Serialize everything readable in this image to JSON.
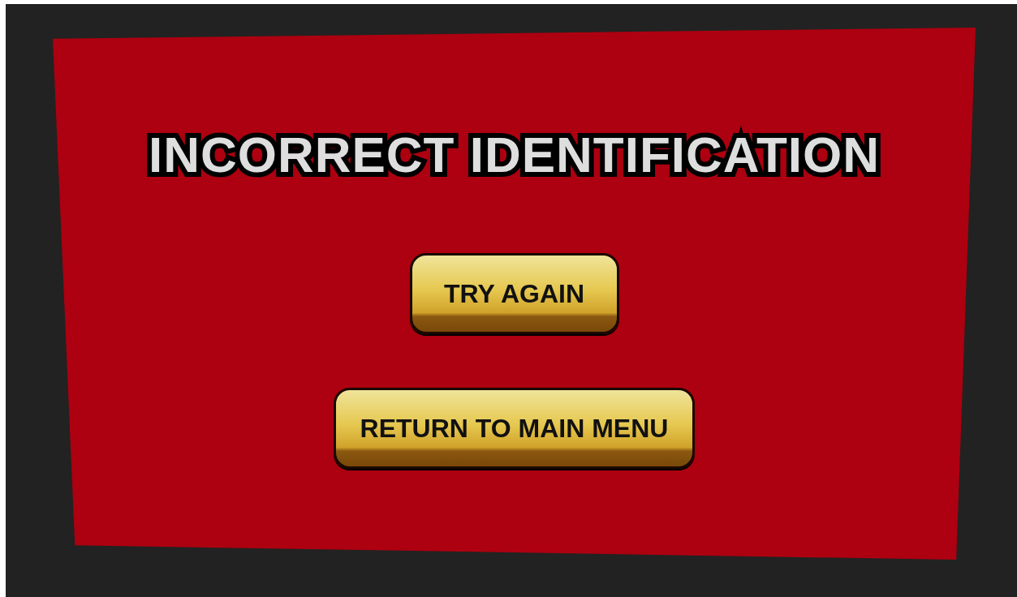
{
  "title": "INCORRECT IDENTIFICATION",
  "buttons": [
    {
      "label": "TRY AGAIN"
    },
    {
      "label": "RETURN TO MAIN MENU"
    }
  ]
}
